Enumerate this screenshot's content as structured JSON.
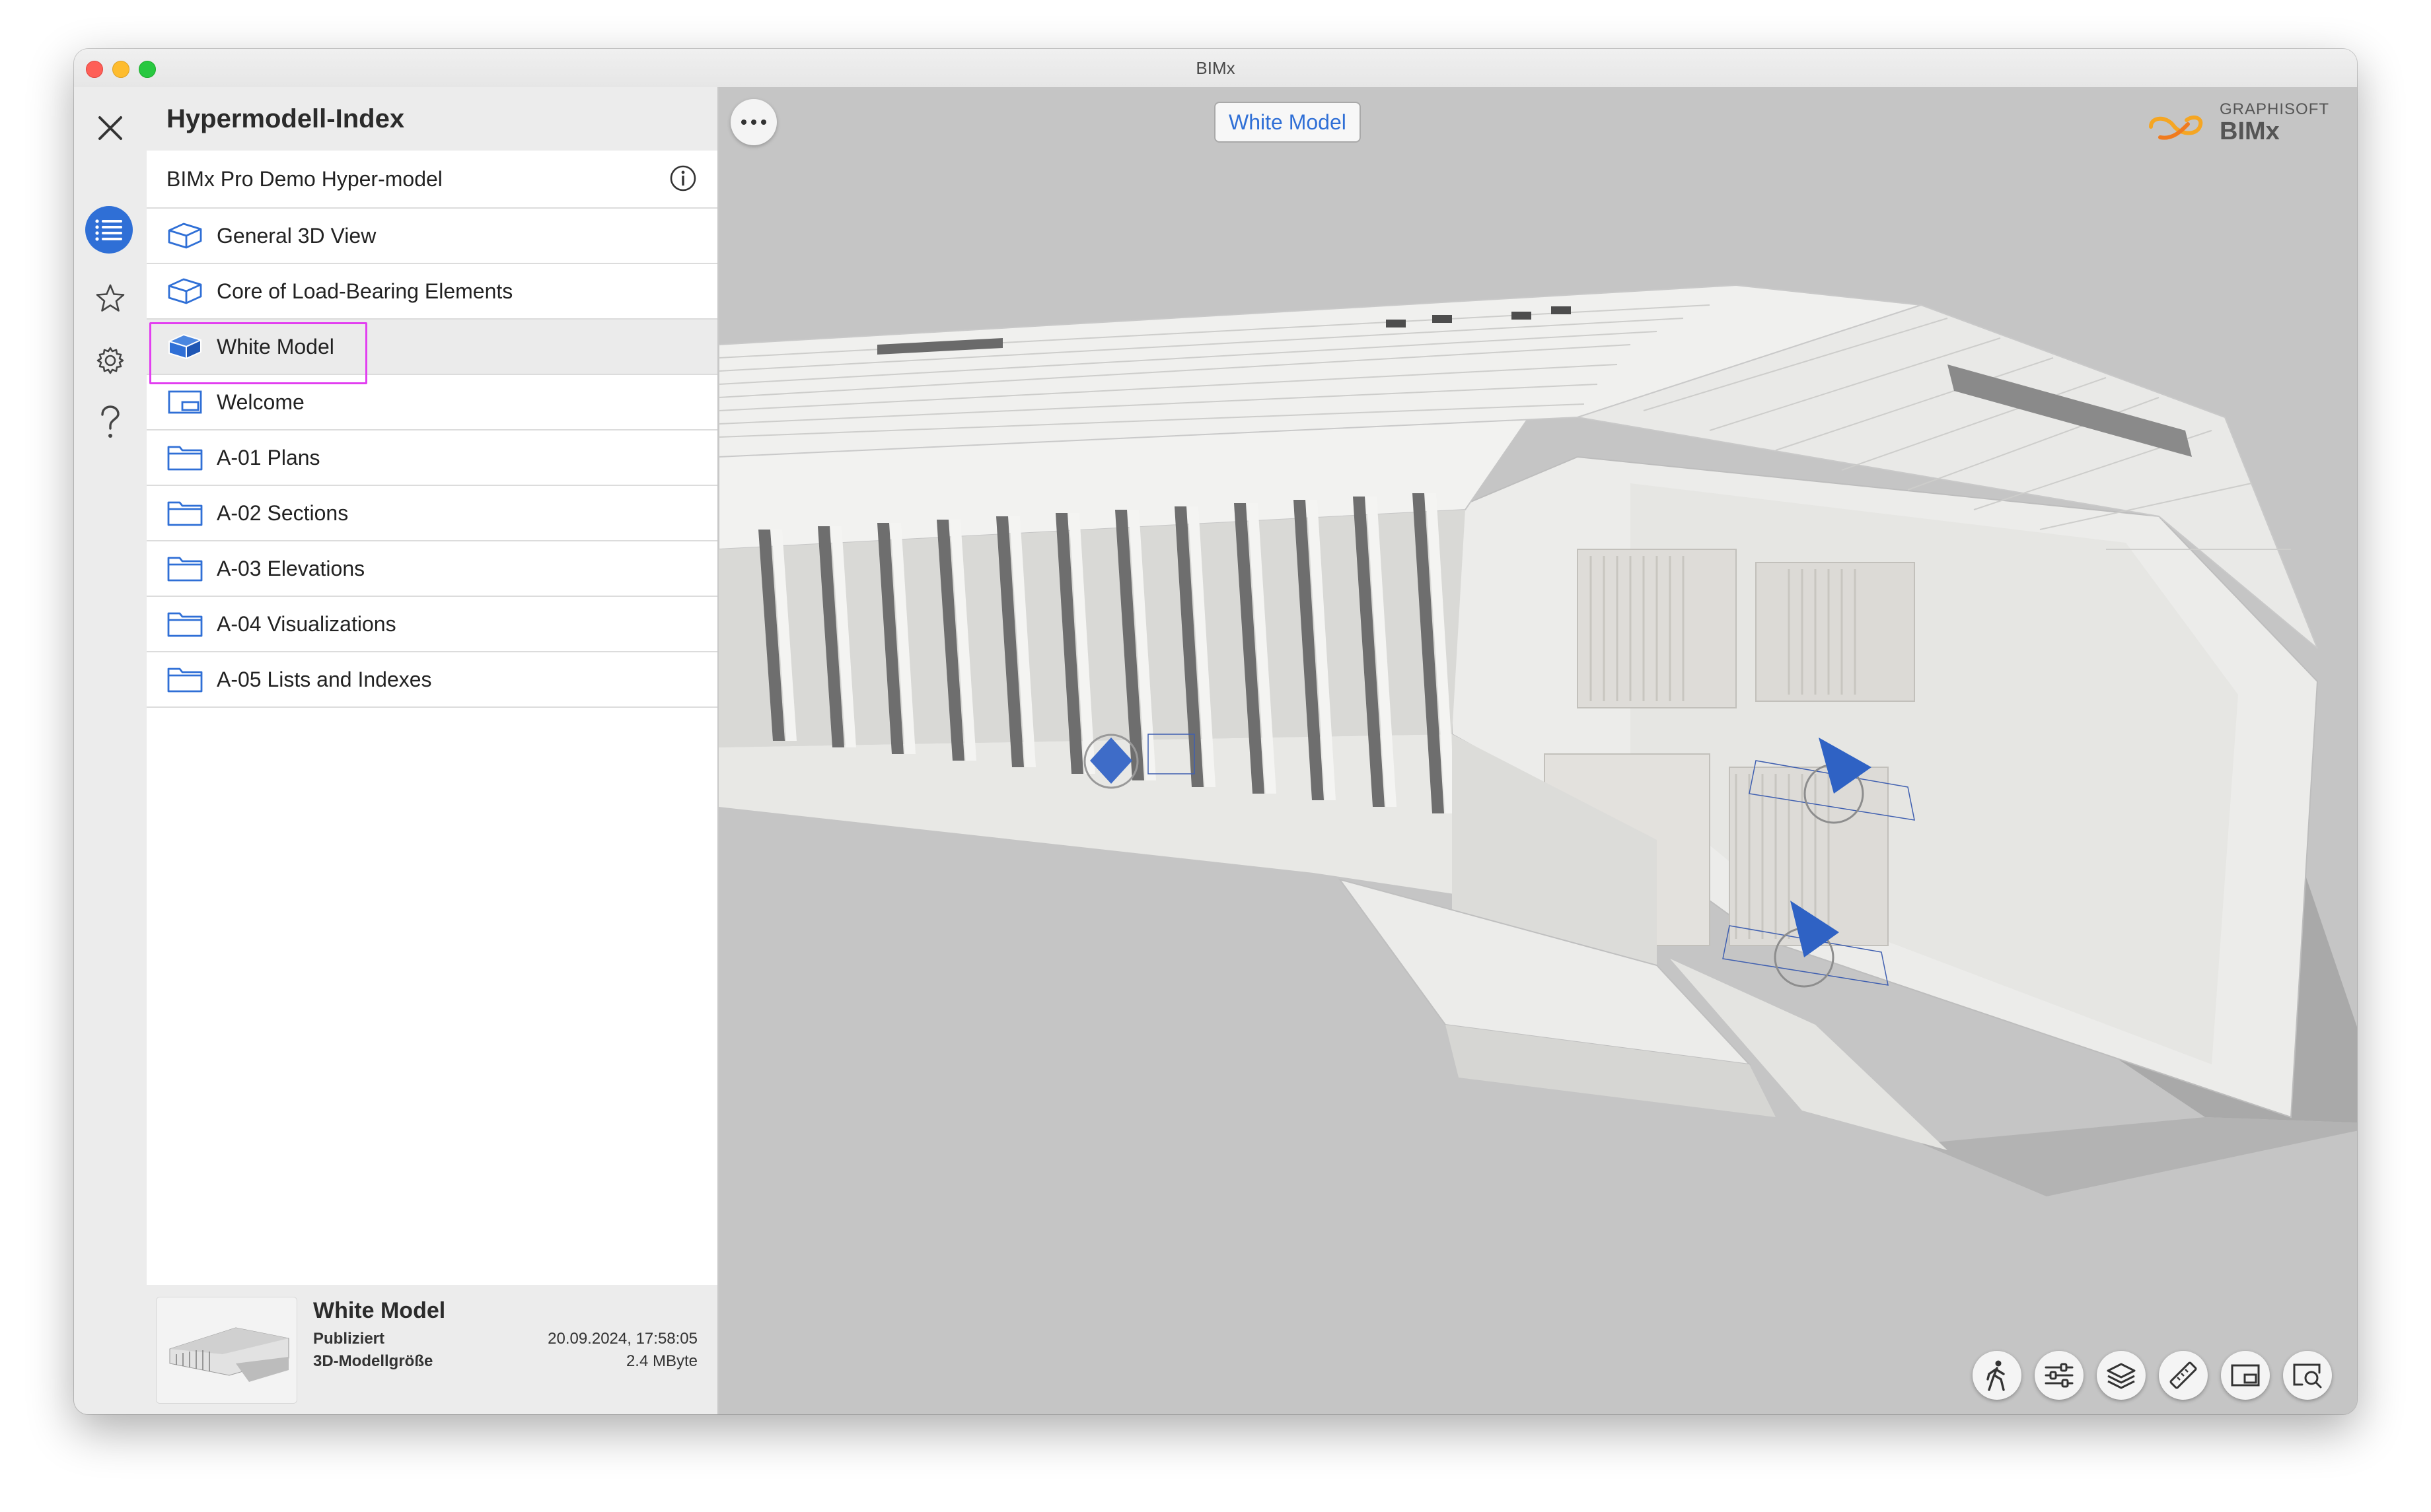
{
  "window": {
    "title": "BIMx"
  },
  "panel": {
    "title": "Hypermodell-Index",
    "model_name": "BIMx Pro Demo Hyper-model",
    "items": [
      {
        "label": "General 3D View",
        "icon": "3d-view-outline-icon"
      },
      {
        "label": "Core of Load-Bearing Elements",
        "icon": "3d-view-outline-icon"
      },
      {
        "label": "White Model",
        "icon": "3d-view-filled-icon",
        "selected": true
      },
      {
        "label": "Welcome",
        "icon": "layout-icon"
      },
      {
        "label": "A-01 Plans",
        "icon": "folder-icon"
      },
      {
        "label": "A-02 Sections",
        "icon": "folder-icon"
      },
      {
        "label": "A-03 Elevations",
        "icon": "folder-icon"
      },
      {
        "label": "A-04 Visualizations",
        "icon": "folder-icon"
      },
      {
        "label": "A-05 Lists and Indexes",
        "icon": "folder-icon"
      }
    ]
  },
  "footer": {
    "title": "White Model",
    "published_label": "Publiziert",
    "published_value": "20.09.2024, 17:58:05",
    "size_label": "3D-Modellgröße",
    "size_value": "2.4 MByte"
  },
  "viewport": {
    "current_view": "White Model",
    "brand_top": "GRAPHISOFT",
    "brand_name": "BIMx"
  },
  "toolbar": [
    "walk-icon",
    "sliders-icon",
    "layers-icon",
    "ruler-icon",
    "layout-icon",
    "zoom-search-icon"
  ],
  "colors": {
    "accent": "#2f6fd6",
    "highlight": "#e23ef0",
    "viewport_bg": "#c5c5c5"
  }
}
